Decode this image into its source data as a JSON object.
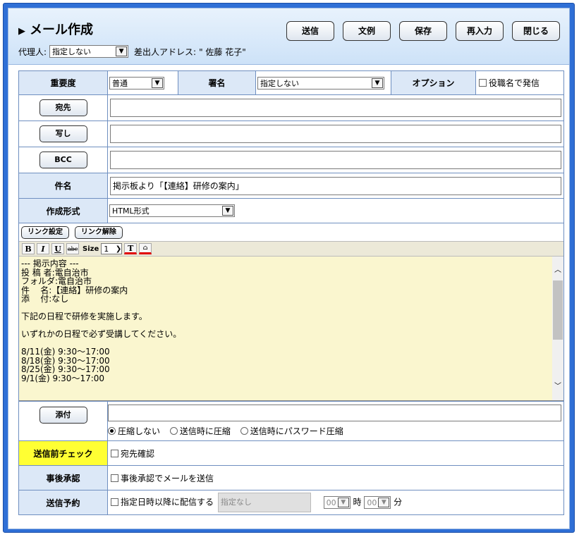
{
  "header": {
    "title": "メール作成",
    "buttons": {
      "send": "送信",
      "template": "文例",
      "save": "保存",
      "reenter": "再入力",
      "close": "閉じる"
    },
    "agent_label": "代理人:",
    "agent_value": "指定しない",
    "sender_label": "差出人アドレス:",
    "sender_value": "\" 佐藤 花子\""
  },
  "form": {
    "importance_label": "重要度",
    "importance_value": "普通",
    "signature_label": "署名",
    "signature_value": "指定しない",
    "option_label": "オプション",
    "option_check": "役職名で発信",
    "to_button": "宛先",
    "cc_button": "写し",
    "bcc_button": "BCC",
    "subject_label": "件名",
    "subject_value": "掲示板より「【連絡】研修の案内」",
    "format_label": "作成形式",
    "format_value": "HTML形式",
    "link_set": "リンク設定",
    "link_remove": "リンク解除",
    "toolbar": {
      "bold": "B",
      "italic": "I",
      "underline": "U",
      "strike": "abc",
      "size_label": "Size",
      "size_value": "1",
      "text_color": "T"
    },
    "body_text": "--- 掲示内容 ---\n投 稿 者:電自治市\nフォルダ:電自治市\n件    名:【連絡】研修の案内\n添    付:なし\n\n下記の日程で研修を実施します。\n\nいずれかの日程で必ず受講してください。\n\n8/11(金) 9:30〜17:00\n8/18(金) 9:30〜17:00\n8/25(金) 9:30〜17:00\n9/1(金) 9:30〜17:00",
    "attach_button": "添付",
    "compress": {
      "none": "圧縮しない",
      "on_send": "送信時に圧縮",
      "password": "送信時にパスワード圧縮"
    },
    "precheck_label": "送信前チェック",
    "precheck_option": "宛先確認",
    "approval_label": "事後承認",
    "approval_option": "事後承認でメールを送信",
    "schedule_label": "送信予約",
    "schedule_option": "指定日時以降に配信する",
    "schedule_date": "指定なし",
    "hour_value": "00",
    "hour_unit": "時",
    "minute_value": "00",
    "minute_unit": "分"
  },
  "colors": {
    "frame": "#2f6fd6",
    "label_bg": "#dce8f7",
    "editor_bg": "#faf6cf",
    "highlight": "#ffff33"
  }
}
